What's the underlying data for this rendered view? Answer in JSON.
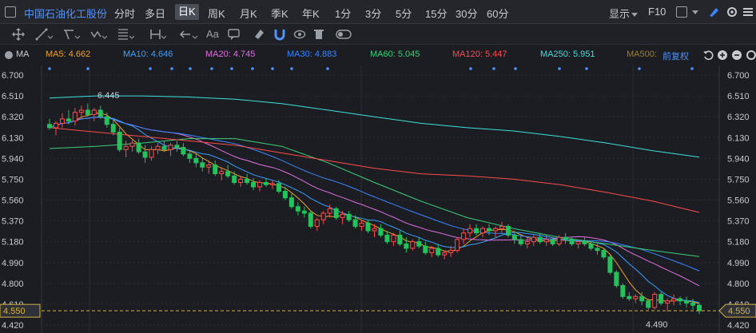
{
  "header": {
    "stock_name": "中国石油化工股份",
    "periods": [
      "分时",
      "多日",
      "日K",
      "周K",
      "月K",
      "季K",
      "年K",
      "1分",
      "3分",
      "5分",
      "15分",
      "30分",
      "60分"
    ],
    "active_period": "日K",
    "display_menu": "显示",
    "f10": "F10"
  },
  "toolbar": {
    "text_tool": "Aa"
  },
  "ma_legend": {
    "title": "MA",
    "items": [
      {
        "label": "MA5: 4.662",
        "color": "#f0a030"
      },
      {
        "label": "MA10: 4.646",
        "color": "#3ca0ff"
      },
      {
        "label": "MA20: 4.745",
        "color": "#e070e0"
      },
      {
        "label": "MA30: 4.883",
        "color": "#3a86ff"
      },
      {
        "label": "MA60: 5.045",
        "color": "#3ccf7a"
      },
      {
        "label": "MA120: 5.447",
        "color": "#ff4b4b"
      },
      {
        "label": "MA250: 5.951",
        "color": "#3ee0e0"
      },
      {
        "label": "MA500: ",
        "color": "#a08020"
      }
    ],
    "adjust": "前复权"
  },
  "chart_data": {
    "type": "candlestick",
    "yticks": [
      "6.700",
      "6.510",
      "6.320",
      "6.130",
      "5.940",
      "5.750",
      "5.560",
      "5.370",
      "5.180",
      "4.990",
      "4.800",
      "4.610",
      "4.420"
    ],
    "ylim": [
      4.42,
      6.7
    ],
    "current_price": "4.550",
    "annotations": {
      "high": "6.445",
      "low": "4.490"
    },
    "candles": [
      [
        6.25,
        6.3,
        6.2,
        6.22
      ],
      [
        6.22,
        6.28,
        6.15,
        6.26
      ],
      [
        6.26,
        6.35,
        6.22,
        6.3
      ],
      [
        6.3,
        6.38,
        6.25,
        6.28
      ],
      [
        6.28,
        6.4,
        6.24,
        6.36
      ],
      [
        6.36,
        6.42,
        6.3,
        6.38
      ],
      [
        6.38,
        6.44,
        6.32,
        6.34
      ],
      [
        6.34,
        6.4,
        6.28,
        6.38
      ],
      [
        6.38,
        6.42,
        6.3,
        6.32
      ],
      [
        6.32,
        6.36,
        6.22,
        6.25
      ],
      [
        6.25,
        6.3,
        6.15,
        6.18
      ],
      [
        6.18,
        6.22,
        6.0,
        6.02
      ],
      [
        6.02,
        6.1,
        5.95,
        6.05
      ],
      [
        6.05,
        6.12,
        6.0,
        6.08
      ],
      [
        6.08,
        6.12,
        5.98,
        6.0
      ],
      [
        6.0,
        6.06,
        5.9,
        5.95
      ],
      [
        5.95,
        6.05,
        5.92,
        6.02
      ],
      [
        6.02,
        6.08,
        5.98,
        6.05
      ],
      [
        6.05,
        6.1,
        6.0,
        6.02
      ],
      [
        6.02,
        6.08,
        5.96,
        6.06
      ],
      [
        6.06,
        6.1,
        6.0,
        6.04
      ],
      [
        6.04,
        6.08,
        5.96,
        5.98
      ],
      [
        5.98,
        6.02,
        5.9,
        5.94
      ],
      [
        5.94,
        5.98,
        5.86,
        5.9
      ],
      [
        5.9,
        5.95,
        5.82,
        5.86
      ],
      [
        5.86,
        5.92,
        5.8,
        5.88
      ],
      [
        5.88,
        5.92,
        5.78,
        5.8
      ],
      [
        5.8,
        5.86,
        5.74,
        5.82
      ],
      [
        5.82,
        5.88,
        5.76,
        5.78
      ],
      [
        5.78,
        5.82,
        5.7,
        5.72
      ],
      [
        5.72,
        5.78,
        5.68,
        5.75
      ],
      [
        5.75,
        5.8,
        5.7,
        5.72
      ],
      [
        5.72,
        5.76,
        5.65,
        5.68
      ],
      [
        5.68,
        5.74,
        5.64,
        5.72
      ],
      [
        5.72,
        5.76,
        5.68,
        5.7
      ],
      [
        5.7,
        5.74,
        5.66,
        5.71
      ],
      [
        5.71,
        5.74,
        5.62,
        5.64
      ],
      [
        5.64,
        5.68,
        5.56,
        5.58
      ],
      [
        5.58,
        5.62,
        5.48,
        5.5
      ],
      [
        5.5,
        5.54,
        5.42,
        5.46
      ],
      [
        5.46,
        5.5,
        5.4,
        5.44
      ],
      [
        5.44,
        5.46,
        5.3,
        5.32
      ],
      [
        5.32,
        5.4,
        5.28,
        5.38
      ],
      [
        5.38,
        5.46,
        5.34,
        5.44
      ],
      [
        5.44,
        5.52,
        5.4,
        5.48
      ],
      [
        5.48,
        5.5,
        5.38,
        5.4
      ],
      [
        5.4,
        5.46,
        5.34,
        5.43
      ],
      [
        5.43,
        5.46,
        5.36,
        5.38
      ],
      [
        5.38,
        5.42,
        5.3,
        5.32
      ],
      [
        5.32,
        5.38,
        5.28,
        5.35
      ],
      [
        5.35,
        5.38,
        5.26,
        5.28
      ],
      [
        5.28,
        5.34,
        5.22,
        5.3
      ],
      [
        5.3,
        5.34,
        5.22,
        5.24
      ],
      [
        5.24,
        5.28,
        5.16,
        5.18
      ],
      [
        5.18,
        5.26,
        5.14,
        5.24
      ],
      [
        5.24,
        5.28,
        5.14,
        5.16
      ],
      [
        5.16,
        5.22,
        5.08,
        5.12
      ],
      [
        5.12,
        5.2,
        5.1,
        5.18
      ],
      [
        5.18,
        5.22,
        5.12,
        5.14
      ],
      [
        5.14,
        5.18,
        5.06,
        5.08
      ],
      [
        5.08,
        5.14,
        5.04,
        5.12
      ],
      [
        5.12,
        5.16,
        5.04,
        5.06
      ],
      [
        5.06,
        5.1,
        5.02,
        5.08
      ],
      [
        5.08,
        5.14,
        5.04,
        5.1
      ],
      [
        5.1,
        5.22,
        5.08,
        5.2
      ],
      [
        5.2,
        5.3,
        5.16,
        5.26
      ],
      [
        5.26,
        5.34,
        5.22,
        5.3
      ],
      [
        5.3,
        5.34,
        5.24,
        5.26
      ],
      [
        5.26,
        5.32,
        5.22,
        5.3
      ],
      [
        5.3,
        5.34,
        5.24,
        5.28
      ],
      [
        5.28,
        5.32,
        5.22,
        5.3
      ],
      [
        5.3,
        5.36,
        5.26,
        5.32
      ],
      [
        5.32,
        5.34,
        5.22,
        5.24
      ],
      [
        5.24,
        5.28,
        5.16,
        5.2
      ],
      [
        5.2,
        5.24,
        5.14,
        5.16
      ],
      [
        5.16,
        5.22,
        5.12,
        5.18
      ],
      [
        5.18,
        5.24,
        5.14,
        5.22
      ],
      [
        5.22,
        5.26,
        5.16,
        5.18
      ],
      [
        5.18,
        5.24,
        5.14,
        5.2
      ],
      [
        5.2,
        5.22,
        5.14,
        5.16
      ],
      [
        5.16,
        5.24,
        5.14,
        5.22
      ],
      [
        5.22,
        5.26,
        5.16,
        5.2
      ],
      [
        5.2,
        5.22,
        5.14,
        5.16
      ],
      [
        5.16,
        5.2,
        5.12,
        5.18
      ],
      [
        5.18,
        5.22,
        5.14,
        5.16
      ],
      [
        5.16,
        5.18,
        5.1,
        5.12
      ],
      [
        5.12,
        5.16,
        5.06,
        5.1
      ],
      [
        5.1,
        5.12,
        5.02,
        5.04
      ],
      [
        5.04,
        5.06,
        4.88,
        4.9
      ],
      [
        4.9,
        4.92,
        4.76,
        4.78
      ],
      [
        4.78,
        4.8,
        4.66,
        4.68
      ],
      [
        4.68,
        4.72,
        4.64,
        4.66
      ],
      [
        4.66,
        4.7,
        4.62,
        4.68
      ],
      [
        4.68,
        4.72,
        4.6,
        4.64
      ],
      [
        4.64,
        4.66,
        4.56,
        4.58
      ],
      [
        4.58,
        4.72,
        4.56,
        4.7
      ],
      [
        4.7,
        4.72,
        4.6,
        4.62
      ],
      [
        4.62,
        4.66,
        4.54,
        4.64
      ],
      [
        4.64,
        4.7,
        4.6,
        4.66
      ],
      [
        4.66,
        4.68,
        4.6,
        4.64
      ],
      [
        4.64,
        4.68,
        4.58,
        4.62
      ],
      [
        4.62,
        4.66,
        4.56,
        4.6
      ],
      [
        4.6,
        4.62,
        4.52,
        4.55
      ]
    ]
  }
}
